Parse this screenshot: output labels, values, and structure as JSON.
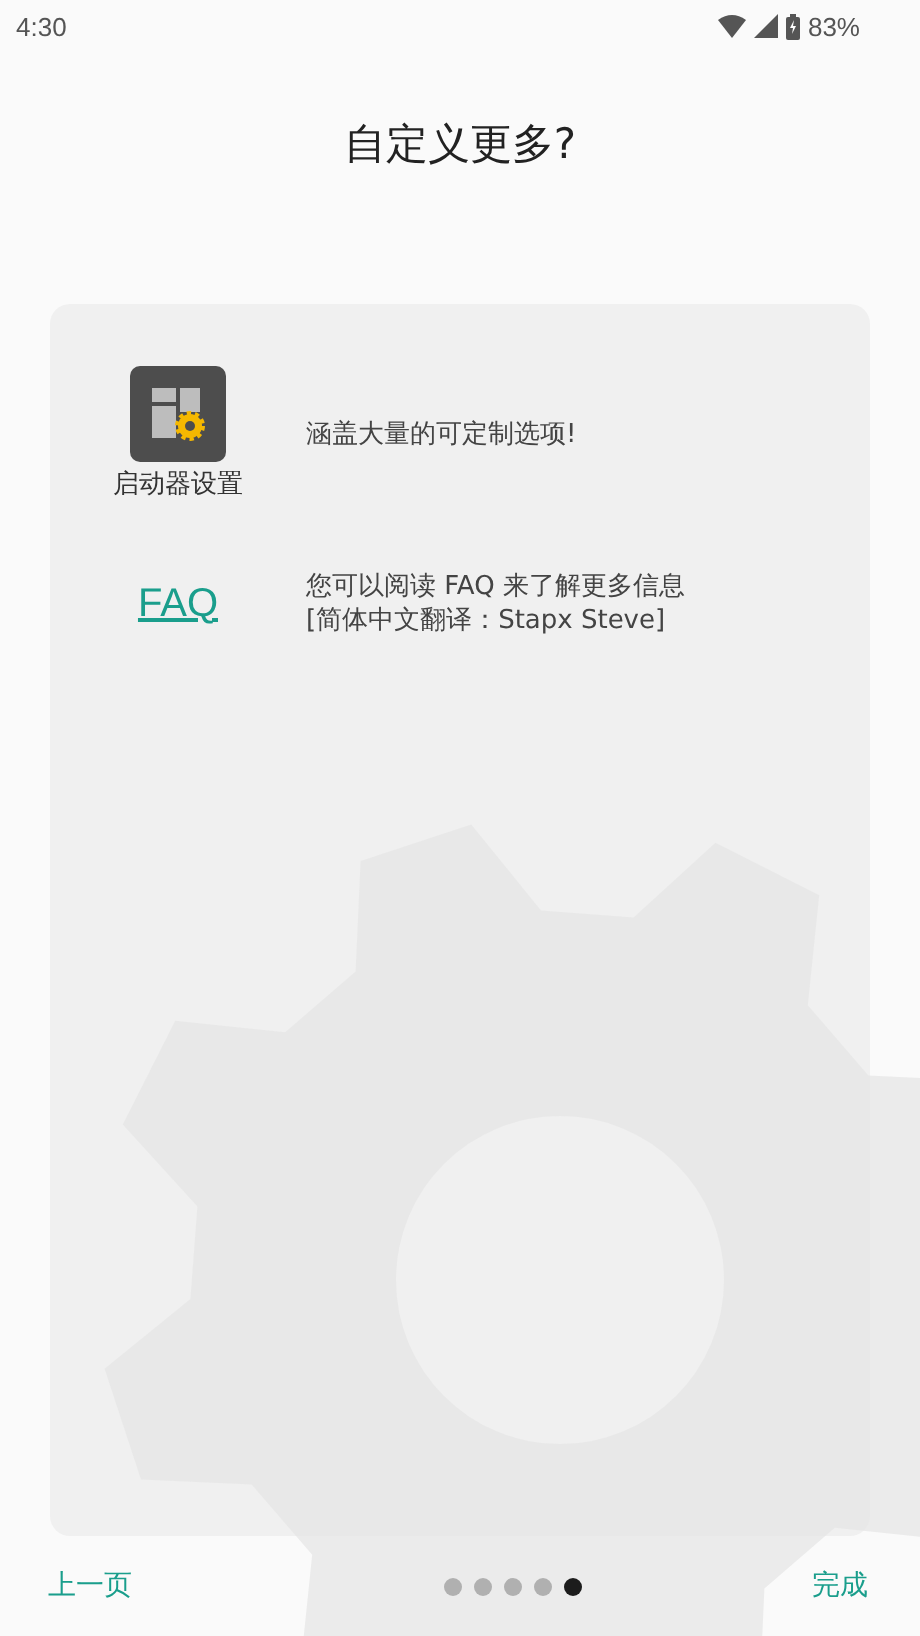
{
  "status_bar": {
    "time": "4:30",
    "battery": "83%"
  },
  "title": "自定义更多?",
  "items": [
    {
      "kind": "app",
      "label": "启动器设置",
      "description": "涵盖大量的可定制选项!"
    },
    {
      "kind": "link",
      "label": "FAQ",
      "description": "您可以阅读 FAQ 来了解更多信息\n[简体中文翻译：Stapx Steve]"
    }
  ],
  "nav": {
    "back": "上一页",
    "done": "完成",
    "pages": [
      {
        "selected": false
      },
      {
        "selected": false
      },
      {
        "selected": false
      },
      {
        "selected": false
      },
      {
        "selected": true
      }
    ]
  }
}
